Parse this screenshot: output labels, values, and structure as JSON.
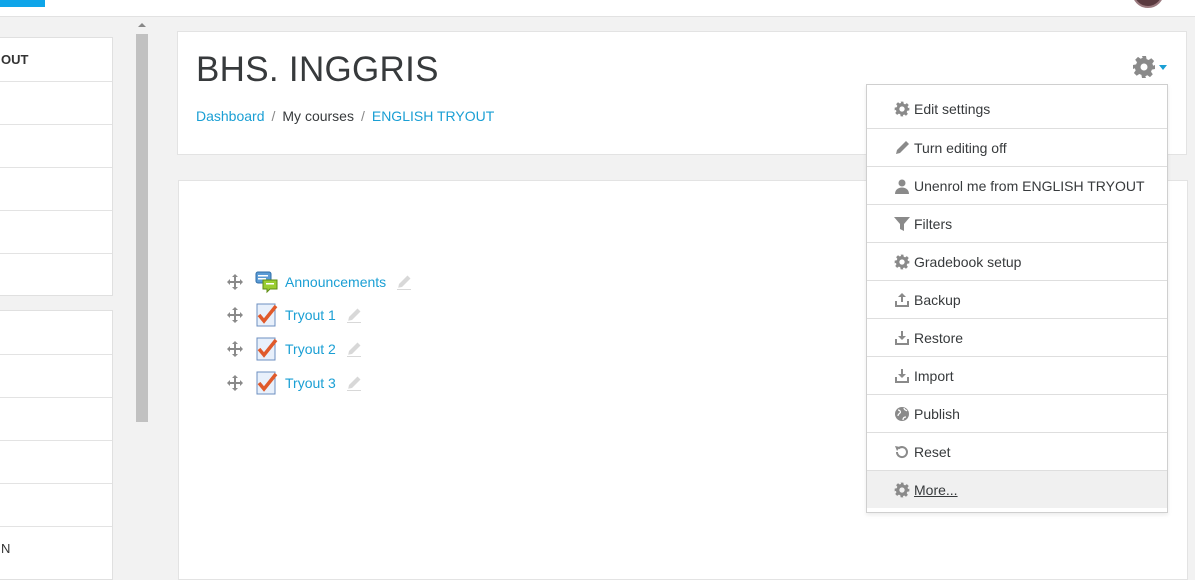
{
  "left_panel": {
    "block1_rows": [
      "OUT",
      "",
      "",
      "",
      "",
      ""
    ],
    "block2_rows": [
      "",
      "",
      "",
      "",
      "",
      "N"
    ]
  },
  "header": {
    "title": "BHS. INGGRIS",
    "breadcrumb": [
      {
        "label": "Dashboard",
        "link": true
      },
      {
        "label": "My courses",
        "link": false
      },
      {
        "label": "ENGLISH TRYOUT",
        "link": true
      }
    ],
    "separator": "/"
  },
  "course_menu": {
    "trigger_icon": "gear-icon",
    "items": [
      {
        "label": "Edit settings",
        "icon": "gear-icon"
      },
      {
        "label": "Turn editing off",
        "icon": "pencil-icon"
      },
      {
        "label": "Unenrol me from ENGLISH TRYOUT",
        "icon": "user-icon"
      },
      {
        "label": "Filters",
        "icon": "filter-icon"
      },
      {
        "label": "Gradebook setup",
        "icon": "gear-icon"
      },
      {
        "label": "Backup",
        "icon": "upload-icon"
      },
      {
        "label": "Restore",
        "icon": "download-icon"
      },
      {
        "label": "Import",
        "icon": "download-icon"
      },
      {
        "label": "Publish",
        "icon": "globe-icon"
      },
      {
        "label": "Reset",
        "icon": "reset-icon"
      },
      {
        "label": "More...",
        "icon": "gear-icon",
        "highlighted": true
      }
    ]
  },
  "activities": [
    {
      "name": "Announcements",
      "type": "forum"
    },
    {
      "name": "Tryout 1",
      "type": "quiz"
    },
    {
      "name": "Tryout 2",
      "type": "quiz"
    },
    {
      "name": "Tryout 3",
      "type": "quiz"
    }
  ],
  "colors": {
    "link": "#1a9fd4",
    "icon_grey": "#8a8a8a",
    "quiz_check": "#e05a2b"
  }
}
